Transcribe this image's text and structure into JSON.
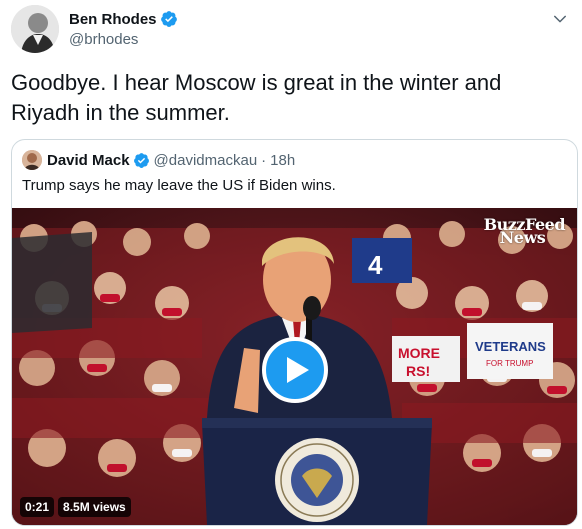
{
  "tweet": {
    "author": {
      "display_name": "Ben Rhodes",
      "handle": "@brhodes",
      "verified": true
    },
    "text": "Goodbye. I hear Moscow is great in the winter and Riyadh in the summer."
  },
  "quoted_tweet": {
    "author": {
      "display_name": "David Mack",
      "handle": "@davidmackau",
      "verified": true
    },
    "separator": "·",
    "time": "18h",
    "text": "Trump says he may leave the US if Biden wins.",
    "media": {
      "type": "video",
      "watermark_line1": "BuzzFeed",
      "watermark_line2": "News",
      "duration": "0:21",
      "views": "8.5M views",
      "sign_more": "MORE",
      "sign_more2": "RS!",
      "sign_veterans": "VETERANS",
      "sign_veterans_sub": "FOR TRUMP",
      "sign_4": "4",
      "seal_text": "PRESIDENT OF THE UNITED STATES"
    }
  },
  "colors": {
    "accent": "#1d9bf0",
    "text": "#0f1419",
    "secondary": "#536471",
    "border": "#cfd9de"
  },
  "icons": {
    "verified": "verified-badge-icon",
    "menu": "chevron-down-icon",
    "play": "play-icon"
  }
}
